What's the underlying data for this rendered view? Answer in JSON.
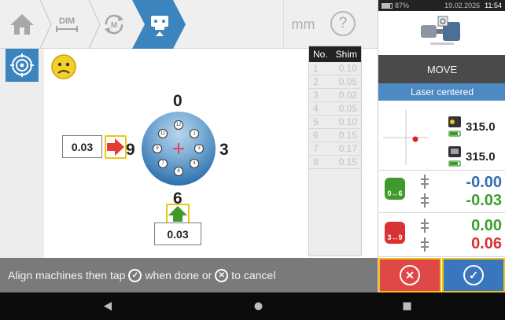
{
  "toolbar": {
    "dim_label": "DIM",
    "unit": "mm",
    "help": "?"
  },
  "main": {
    "label_top": "0",
    "label_right": "3",
    "label_bottom": "6",
    "label_left": "9",
    "dots": [
      "12",
      "1",
      "3",
      "4",
      "6",
      "7",
      "9",
      "11"
    ],
    "value_left": "0.03",
    "value_bottom": "0.03"
  },
  "shim": {
    "col_no": "No.",
    "col_shim": "Shim",
    "rows": [
      {
        "no": "1",
        "val": "0.10"
      },
      {
        "no": "2",
        "val": "0.05"
      },
      {
        "no": "3",
        "val": "0.02"
      },
      {
        "no": "4",
        "val": "0.05"
      },
      {
        "no": "5",
        "val": "0.10"
      },
      {
        "no": "6",
        "val": "0.15"
      },
      {
        "no": "7",
        "val": "0.17"
      },
      {
        "no": "8",
        "val": "0.15"
      }
    ]
  },
  "status": {
    "text_a": "Align machines then tap",
    "text_b": "when done or",
    "text_c": "to cancel"
  },
  "right": {
    "battery": "87%",
    "date": "19.02.2026",
    "time": "11:54",
    "move": "MOVE",
    "laser": "Laser centered",
    "det1": "315.0",
    "det2": "315.0",
    "badge1": "0↔6",
    "badge2": "3↔9",
    "v06_top": "-0.00",
    "v06_bot": "-0.03",
    "v39_top": "0.00",
    "v39_bot": "0.06"
  },
  "colors": {
    "accent": "#3c84bd",
    "cancel": "#e04848",
    "confirm": "#3a76be",
    "highlight": "#f1c413",
    "green_value": "#3d9f2e",
    "red_value": "#d83232",
    "blue_value": "#2f6fb3",
    "arrow_red": "#e13c36",
    "arrow_green": "#3e9a2c"
  }
}
